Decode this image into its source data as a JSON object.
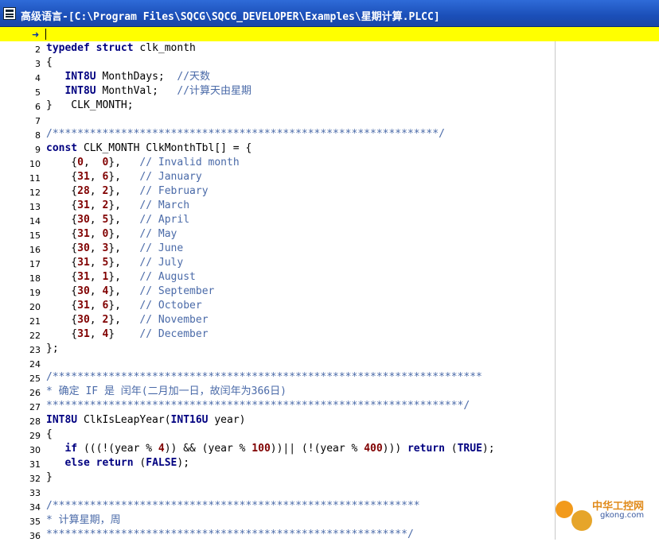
{
  "window": {
    "title": "高级语言-[C:\\Program Files\\SQCG\\SQCG_DEVELOPER\\Examples\\星期计算.PLCC]"
  },
  "editor": {
    "lines": [
      {
        "n": "",
        "text": ""
      },
      {
        "n": "2",
        "text": "typedef struct clk_month"
      },
      {
        "n": "3",
        "text": "{"
      },
      {
        "n": "4",
        "text": "   INT8U MonthDays;  //天数"
      },
      {
        "n": "5",
        "text": "   INT8U MonthVal;   //计算天由星期"
      },
      {
        "n": "6",
        "text": "}   CLK_MONTH;"
      },
      {
        "n": "7",
        "text": ""
      },
      {
        "n": "8",
        "text": "/**************************************************************/"
      },
      {
        "n": "9",
        "text": "const CLK_MONTH ClkMonthTbl[] = {"
      },
      {
        "n": "10",
        "text": "    {0,  0},   // Invalid month"
      },
      {
        "n": "11",
        "text": "    {31, 6},   // January"
      },
      {
        "n": "12",
        "text": "    {28, 2},   // February"
      },
      {
        "n": "13",
        "text": "    {31, 2},   // March"
      },
      {
        "n": "14",
        "text": "    {30, 5},   // April"
      },
      {
        "n": "15",
        "text": "    {31, 0},   // May"
      },
      {
        "n": "16",
        "text": "    {30, 3},   // June"
      },
      {
        "n": "17",
        "text": "    {31, 5},   // July"
      },
      {
        "n": "18",
        "text": "    {31, 1},   // August"
      },
      {
        "n": "19",
        "text": "    {30, 4},   // September"
      },
      {
        "n": "20",
        "text": "    {31, 6},   // October"
      },
      {
        "n": "21",
        "text": "    {30, 2},   // November"
      },
      {
        "n": "22",
        "text": "    {31, 4}    // December"
      },
      {
        "n": "23",
        "text": "};"
      },
      {
        "n": "24",
        "text": ""
      },
      {
        "n": "25",
        "text": "/*********************************************************************"
      },
      {
        "n": "26",
        "text": "* 确定 IF 是 闰年(二月加一日，故闰年为366日)"
      },
      {
        "n": "27",
        "text": "*******************************************************************/"
      },
      {
        "n": "28",
        "text": "INT8U ClkIsLeapYear(INT16U year)"
      },
      {
        "n": "29",
        "text": "{"
      },
      {
        "n": "30",
        "text": "   if (((!(year % 4)) && (year % 100))|| (!(year % 400))) return (TRUE);"
      },
      {
        "n": "31",
        "text": "   else return (FALSE);"
      },
      {
        "n": "32",
        "text": "}"
      },
      {
        "n": "33",
        "text": ""
      },
      {
        "n": "34",
        "text": "/***********************************************************"
      },
      {
        "n": "35",
        "text": "* 计算星期，周"
      },
      {
        "n": "36",
        "text": "**********************************************************/"
      }
    ]
  },
  "watermark": {
    "brand": "中华工控网",
    "url": "gkong.com"
  },
  "colors": {
    "keyword": "#000080",
    "comment": "#4a6aa8",
    "number": "#800000",
    "current_line": "#ffff00",
    "titlebar": "#1b4fb8"
  },
  "icons": {
    "app": "app-window-icon",
    "current_line_marker": "arrow-marker-icon"
  }
}
